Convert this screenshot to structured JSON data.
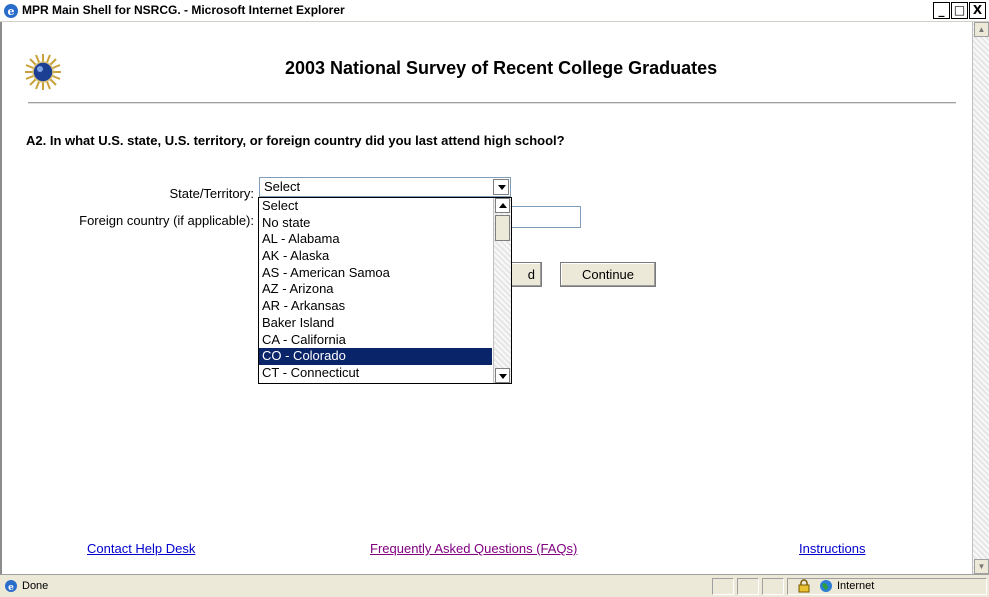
{
  "window": {
    "title": "MPR Main Shell for NSRCG. - Microsoft Internet Explorer",
    "min": "_",
    "max": "□",
    "close": "X"
  },
  "page": {
    "title": "2003 National Survey of Recent College Graduates",
    "question": "A2. In what U.S. state, U.S. territory, or foreign country did you last attend high school?"
  },
  "form": {
    "state_label": "State/Territory:",
    "state_selected": "Select",
    "foreign_label": "Foreign country (if applicable):",
    "foreign_value": "",
    "back_label": "d",
    "continue_label": "Continue"
  },
  "dropdown": {
    "options": [
      "Select",
      "No state",
      "AL - Alabama",
      "AK - Alaska",
      "AS - American Samoa",
      "AZ - Arizona",
      "AR - Arkansas",
      "Baker Island",
      "CA - California",
      "CO - Colorado",
      "CT - Connecticut"
    ],
    "highlighted": "CO - Colorado"
  },
  "footer": {
    "help": "Contact Help Desk",
    "faq": "Frequently Asked Questions (FAQs)",
    "instructions": "Instructions"
  },
  "status": {
    "text": "Done",
    "zone": "Internet"
  },
  "colors": {
    "highlight": "#0a246a",
    "link": "#0000cc",
    "visited_link": "#800080"
  }
}
